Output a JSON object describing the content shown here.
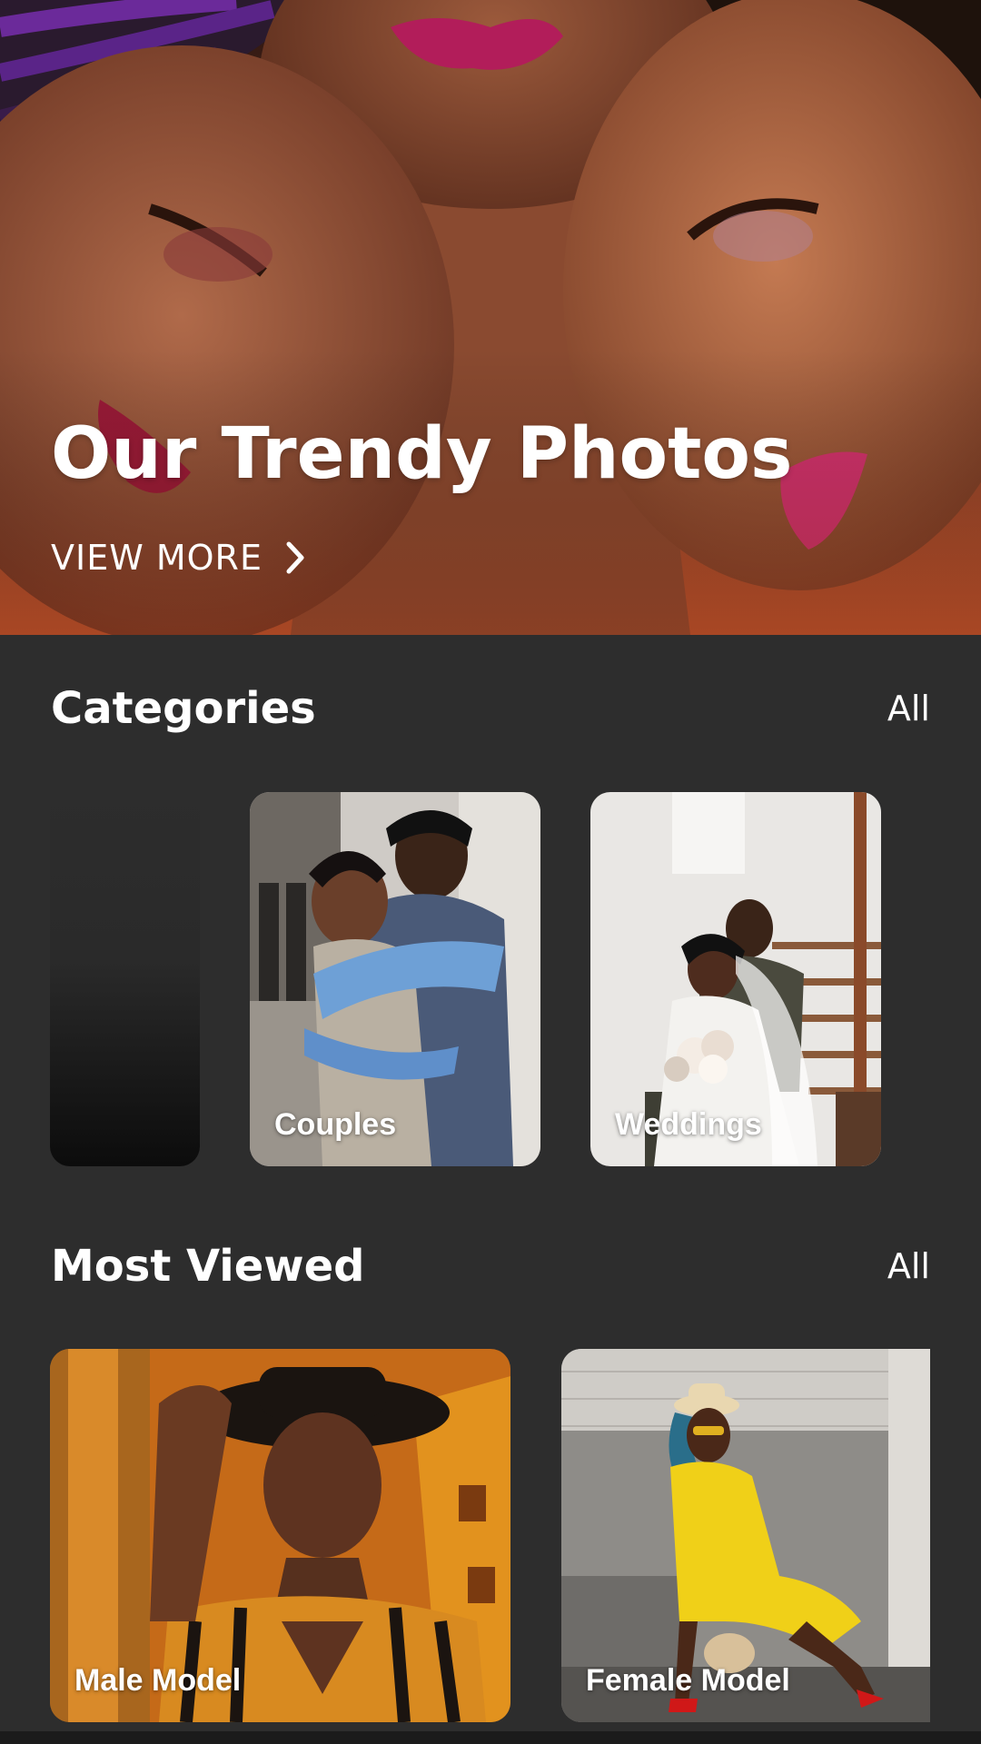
{
  "hero": {
    "title": "Our Trendy Photos",
    "view_more_label": "VIEW MORE",
    "chevron_icon": "chevron-right-icon"
  },
  "categories": {
    "title": "Categories",
    "all_label": "All",
    "items": [
      {
        "label": ""
      },
      {
        "label": "Couples"
      },
      {
        "label": "Weddings"
      }
    ]
  },
  "most_viewed": {
    "title": "Most Viewed",
    "all_label": "All",
    "items": [
      {
        "label": "Male Model"
      },
      {
        "label": "Female Model"
      }
    ]
  },
  "colors": {
    "background": "#2d2d2d",
    "text": "#ffffff",
    "hero_tint": "#c4552f"
  }
}
